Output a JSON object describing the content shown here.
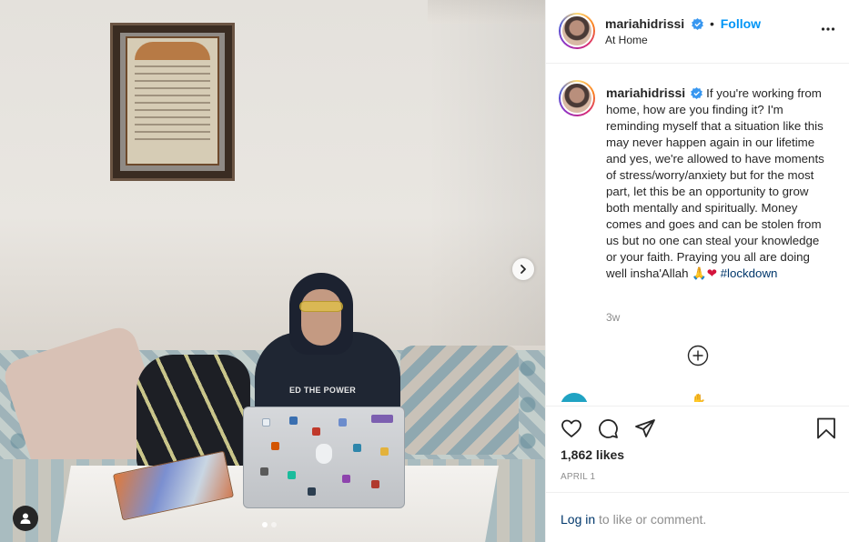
{
  "post": {
    "username": "mariahidrissi",
    "follow_label": "Follow",
    "location": "At Home",
    "caption_text": "If you're working from home, how are you finding it? I'm reminding myself that a situation like this may never happen again in our lifetime and yes, we're allowed to have moments of stress/worry/anxiety but for the most part, let this be an opportunity to grow both mentally and spiritually. Money comes and goes and can be stolen from us but no one can steal your knowledge or your faith. Praying you all are doing well insha'Allah",
    "caption_emoji": "🙏❤",
    "hashtag": "#lockdown",
    "caption_age": "3w",
    "next_comment_user": "… … … … … … ✋",
    "likes": "1,862 likes",
    "date": "APRIL 1",
    "hoodie_print": "ED THE POWER"
  },
  "login": {
    "link": "Log in",
    "rest": " to like or comment."
  },
  "icons": [
    "verified-icon",
    "more-icon",
    "heart-icon",
    "comment-icon",
    "share-icon",
    "save-icon",
    "plus-circle-icon",
    "chevron-right-icon",
    "user-tag-icon"
  ],
  "colors": {
    "accent": "#0095f6",
    "text": "#262626",
    "muted": "#8e8e8e",
    "hashtag": "#00376b"
  },
  "carousel": {
    "count": 2,
    "active": 0
  }
}
